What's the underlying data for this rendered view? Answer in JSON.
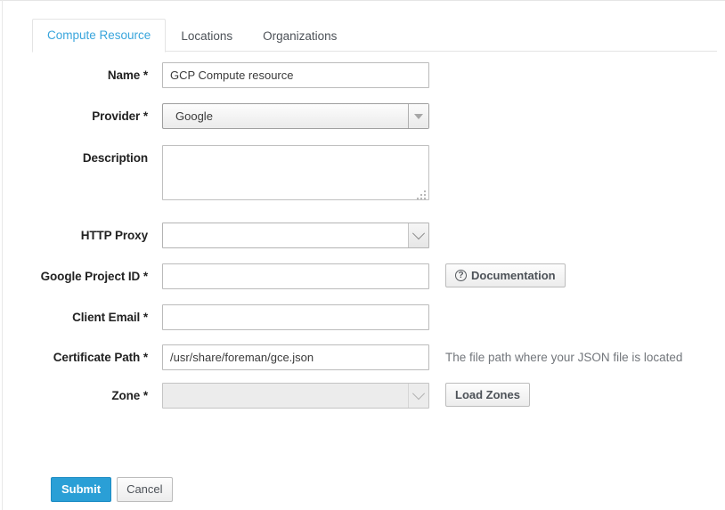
{
  "tabs": [
    {
      "label": "Compute Resource",
      "active": true
    },
    {
      "label": "Locations",
      "active": false
    },
    {
      "label": "Organizations",
      "active": false
    }
  ],
  "form": {
    "name": {
      "label": "Name *",
      "value": "GCP Compute resource",
      "placeholder": ""
    },
    "provider": {
      "label": "Provider *",
      "value": "Google",
      "options": [
        "Google"
      ]
    },
    "description": {
      "label": "Description",
      "value": "",
      "placeholder": ""
    },
    "http_proxy": {
      "label": "HTTP Proxy",
      "value": "",
      "options": [
        ""
      ]
    },
    "google_project_id": {
      "label": "Google Project ID *",
      "value": "",
      "placeholder": "",
      "documentation_button": "Documentation",
      "documentation_icon": "question-circle-icon"
    },
    "client_email": {
      "label": "Client Email *",
      "value": "",
      "placeholder": ""
    },
    "certificate_path": {
      "label": "Certificate Path *",
      "value": "/usr/share/foreman/gce.json",
      "placeholder": "",
      "help": "The file path where your JSON file is located"
    },
    "zone": {
      "label": "Zone *",
      "value": "",
      "disabled": true,
      "load_zones_button": "Load Zones",
      "options": [
        ""
      ]
    }
  },
  "actions": {
    "submit": "Submit",
    "cancel": "Cancel"
  },
  "colors": {
    "accent": "#2a9fd6",
    "tab_active_text": "#39a5dc",
    "label_text": "#222222",
    "help_text": "#72767b",
    "border": "#e4e4e4"
  }
}
